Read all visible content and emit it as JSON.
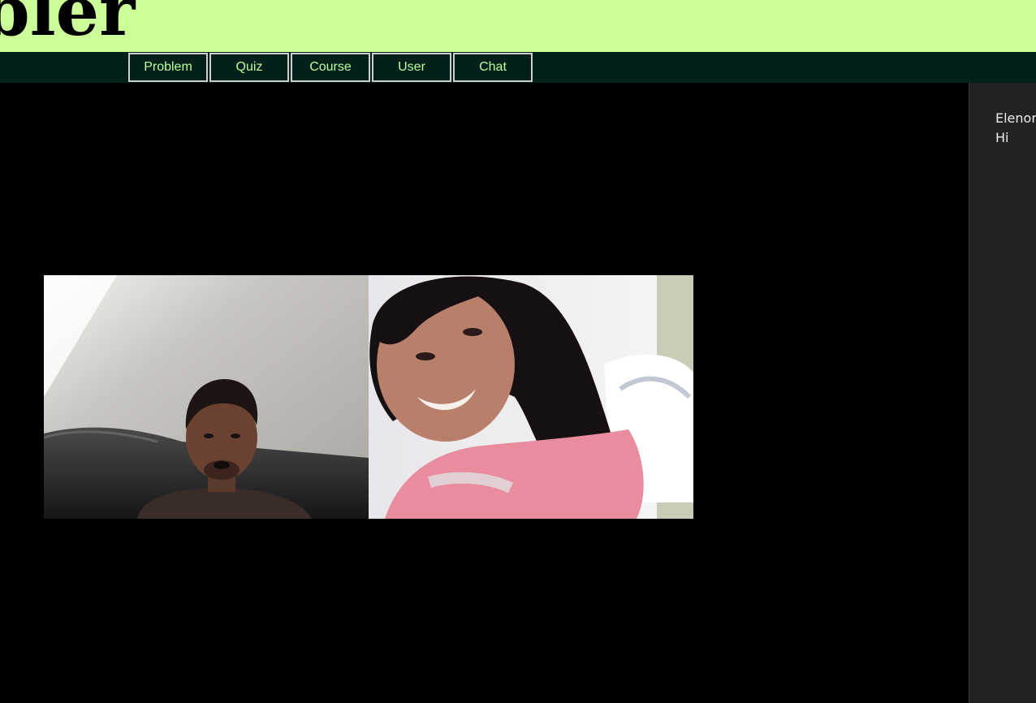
{
  "header": {
    "logo_text": "bler"
  },
  "nav": {
    "items": [
      {
        "label": "Problem"
      },
      {
        "label": "Quiz"
      },
      {
        "label": "Course"
      },
      {
        "label": "User"
      },
      {
        "label": "Chat"
      }
    ]
  },
  "colors": {
    "banner_bg": "#ccff99",
    "navbar_bg": "#03211a",
    "nav_text": "#b8ff9f",
    "chat_panel_bg": "#222222",
    "main_bg": "#000000"
  },
  "video_call": {
    "participants": [
      {
        "feed": "participant-1-video"
      },
      {
        "feed": "participant-2-video"
      }
    ]
  },
  "chat": {
    "messages": [
      {
        "sender": "Elenor",
        "text": "Hi"
      }
    ]
  }
}
